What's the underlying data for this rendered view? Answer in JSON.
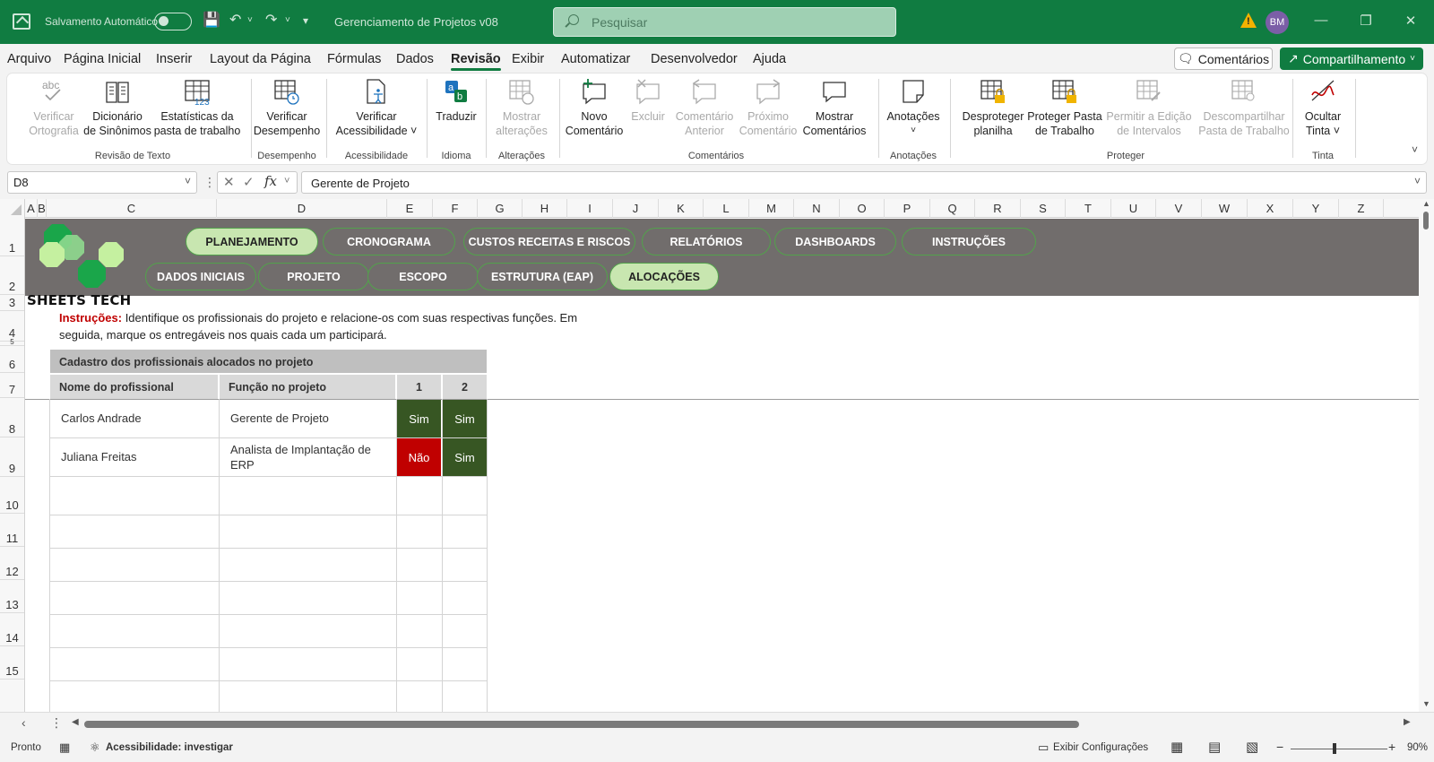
{
  "window": {
    "autosave_label": "Salvamento Automático",
    "doc_title": "Gerenciamento de Projetos v08",
    "search_placeholder": "Pesquisar",
    "avatar_initials": "BM"
  },
  "menu": {
    "tabs": [
      "Arquivo",
      "Página Inicial",
      "Inserir",
      "Layout da Página",
      "Fórmulas",
      "Dados",
      "Revisão",
      "Exibir",
      "Automatizar",
      "Desenvolvedor",
      "Ajuda"
    ],
    "active": "Revisão",
    "comments_button": "Comentários",
    "share_button": "Compartilhamento"
  },
  "ribbon": {
    "verificar_ortografia": [
      "Verificar",
      "Ortografia"
    ],
    "dicionario": [
      "Dicionário",
      "de Sinônimos"
    ],
    "estatisticas": [
      "Estatísticas da",
      "pasta de trabalho"
    ],
    "grp_revisao": "Revisão de Texto",
    "verificar_desempenho": [
      "Verificar",
      "Desempenho"
    ],
    "grp_desempenho": "Desempenho",
    "verificar_acessibilidade": [
      "Verificar",
      "Acessibilidade ˅"
    ],
    "grp_acessibilidade": "Acessibilidade",
    "traduzir": "Traduzir",
    "grp_idioma": "Idioma",
    "mostrar_alteracoes": [
      "Mostrar",
      "alterações"
    ],
    "grp_alteracoes": "Alterações",
    "novo_comentario": [
      "Novo",
      "Comentário"
    ],
    "excluir": "Excluir",
    "comentario_anterior": [
      "Comentário",
      "Anterior"
    ],
    "proximo_comentario": [
      "Próximo",
      "Comentário"
    ],
    "mostrar_comentarios": [
      "Mostrar",
      "Comentários"
    ],
    "grp_comentarios": "Comentários",
    "anotacoes": "Anotações",
    "grp_anotacoes": "Anotações",
    "desproteger": [
      "Desproteger",
      "planilha"
    ],
    "proteger_pasta": [
      "Proteger Pasta",
      "de Trabalho"
    ],
    "permitir_edicao": [
      "Permitir a Edição",
      "de Intervalos"
    ],
    "descompartilhar": [
      "Descompartilhar",
      "Pasta de Trabalho"
    ],
    "grp_proteger": "Proteger",
    "ocultar_tinta": [
      "Ocultar",
      "Tinta ˅"
    ],
    "grp_tinta": "Tinta"
  },
  "formula_bar": {
    "name_box": "D8",
    "formula": "Gerente de Projeto"
  },
  "columns": [
    "A",
    "B",
    "C",
    "D",
    "E",
    "F",
    "G",
    "H",
    "I",
    "J",
    "K",
    "L",
    "M",
    "N",
    "O",
    "P",
    "Q",
    "R",
    "S",
    "T",
    "U",
    "V",
    "W",
    "X",
    "Y",
    "Z"
  ],
  "rows": [
    "1",
    "2",
    "3",
    "4",
    "5",
    "6",
    "7",
    "8",
    "9",
    "10",
    "11",
    "12",
    "13",
    "14",
    "15"
  ],
  "nav": {
    "row1": [
      "PLANEJAMENTO",
      "CRONOGRAMA",
      "CUSTOS RECEITAS E RISCOS",
      "RELATÓRIOS",
      "DASHBOARDS",
      "INSTRUÇÕES"
    ],
    "row2": [
      "DADOS INICIAIS",
      "PROJETO",
      "ESCOPO",
      "ESTRUTURA (EAP)",
      "ALOCAÇÕES"
    ],
    "active_row1": "PLANEJAMENTO",
    "active_row2": "ALOCAÇÕES"
  },
  "brand": "SHEETS TECH",
  "instructions": {
    "label": "Instruções:",
    "text": " Identifique os profissionais do projeto e relacione-os com suas respectivas funções. Em seguida, marque os entregáveis nos quais cada um participará."
  },
  "table": {
    "title": "Cadastro dos profissionais alocados no projeto",
    "headers": [
      "Nome do profissional",
      "Função no projeto",
      "1",
      "2"
    ],
    "rows": [
      {
        "name": "Carlos Andrade",
        "role": "Gerente de Projeto",
        "e1": "Sim",
        "e2": "Sim"
      },
      {
        "name": "Juliana Freitas",
        "role": "Analista de Implantação de ERP",
        "e1": "Não",
        "e2": "Sim"
      }
    ]
  },
  "status": {
    "ready": "Pronto",
    "accessibility": "Acessibilidade: investigar",
    "display_settings": "Exibir Configurações",
    "zoom": "90%"
  },
  "colors": {
    "excel_green": "#107c41",
    "banner_gray": "#716d6c",
    "pill_active": "#c8e6b0",
    "yes_green": "#375623",
    "no_red": "#c00000"
  }
}
